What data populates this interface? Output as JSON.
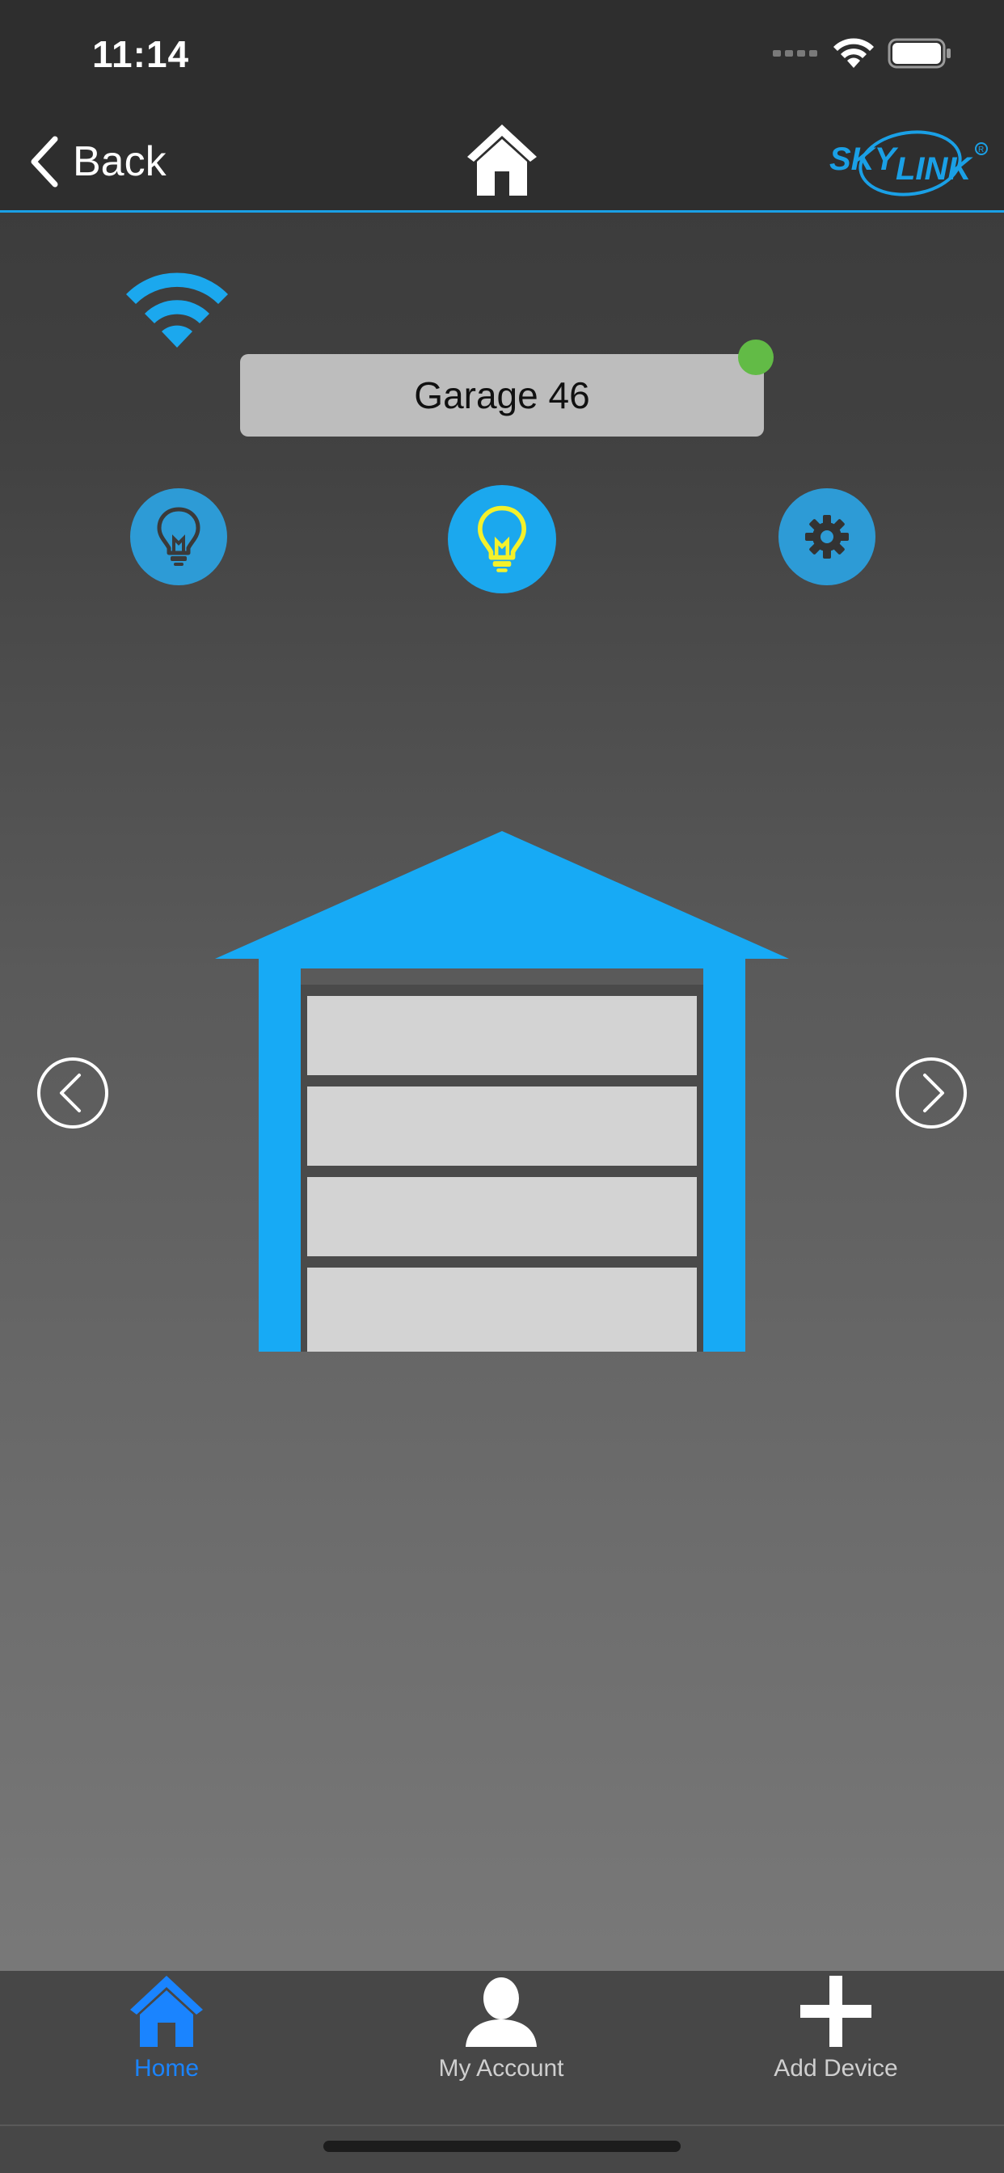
{
  "status_bar": {
    "time": "11:14"
  },
  "nav": {
    "back_label": "Back",
    "brand_text_1": "SKY",
    "brand_text_2": "LINK"
  },
  "device": {
    "name": "Garage 46",
    "online": true
  },
  "tabs": [
    {
      "label": "Home",
      "icon": "home-icon",
      "active": true
    },
    {
      "label": "My Account",
      "icon": "user-icon",
      "active": false
    },
    {
      "label": "Add Device",
      "icon": "plus-icon",
      "active": false
    }
  ],
  "colors": {
    "accent": "#1aa0e6",
    "online": "#62bb46",
    "light_on": "#f4f12b",
    "tab_active": "#1a84ff"
  }
}
